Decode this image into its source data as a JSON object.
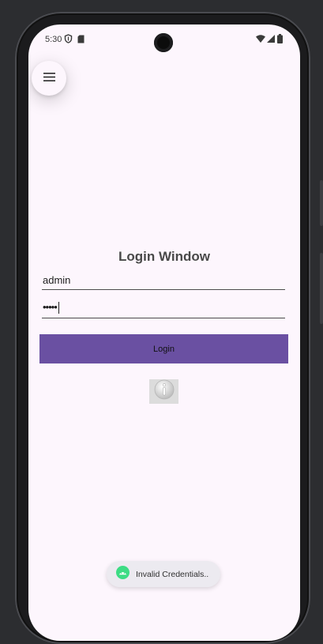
{
  "status_bar": {
    "time": "5:30",
    "left_icons": [
      "shield-icon",
      "sd-card-icon"
    ],
    "right_icons": [
      "wifi-icon",
      "signal-icon",
      "battery-icon"
    ]
  },
  "menu": {
    "icon": "hamburger-menu-icon"
  },
  "login": {
    "title": "Login Window",
    "username_value": "admin",
    "password_masked": "•••••",
    "login_button": "Login",
    "info_icon": "info-icon"
  },
  "toast": {
    "icon": "android-icon",
    "message": "Invalid Credentials.."
  },
  "colors": {
    "background": "#fdf6fd",
    "accent": "#6a50a2",
    "toast_icon": "#3ddc84"
  }
}
